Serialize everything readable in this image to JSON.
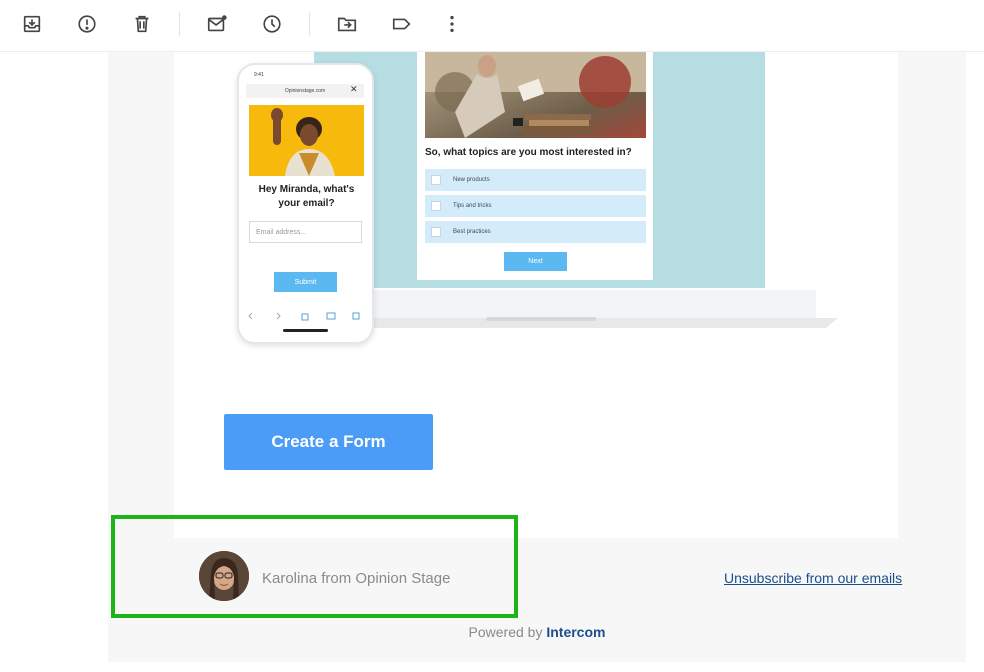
{
  "toolbar": {
    "icons": [
      "archive-icon",
      "report-spam-icon",
      "delete-icon",
      "mark-unread-icon",
      "snooze-icon",
      "move-to-icon",
      "label-icon",
      "more-options-icon"
    ]
  },
  "laptop_form": {
    "question": "So, what topics are you most interested in?",
    "options": [
      "New products",
      "Tips and tricks",
      "Best practices"
    ],
    "next_label": "Next"
  },
  "phone_form": {
    "status_time": "9:41",
    "url": "Opinionstage.com",
    "close": "✕",
    "heading": "Hey Miranda, what's your email?",
    "email_placeholder": "Email address...",
    "submit_label": "Submit"
  },
  "cta": {
    "label": "Create a Form"
  },
  "footer": {
    "sender": "Karolina from Opinion Stage",
    "unsubscribe": "Unsubscribe from our emails",
    "powered_prefix": "Powered by",
    "powered_brand": "Intercom"
  },
  "colors": {
    "cta": "#4a9cf7",
    "highlight": "#1db41a",
    "link": "#1a4e8c"
  }
}
